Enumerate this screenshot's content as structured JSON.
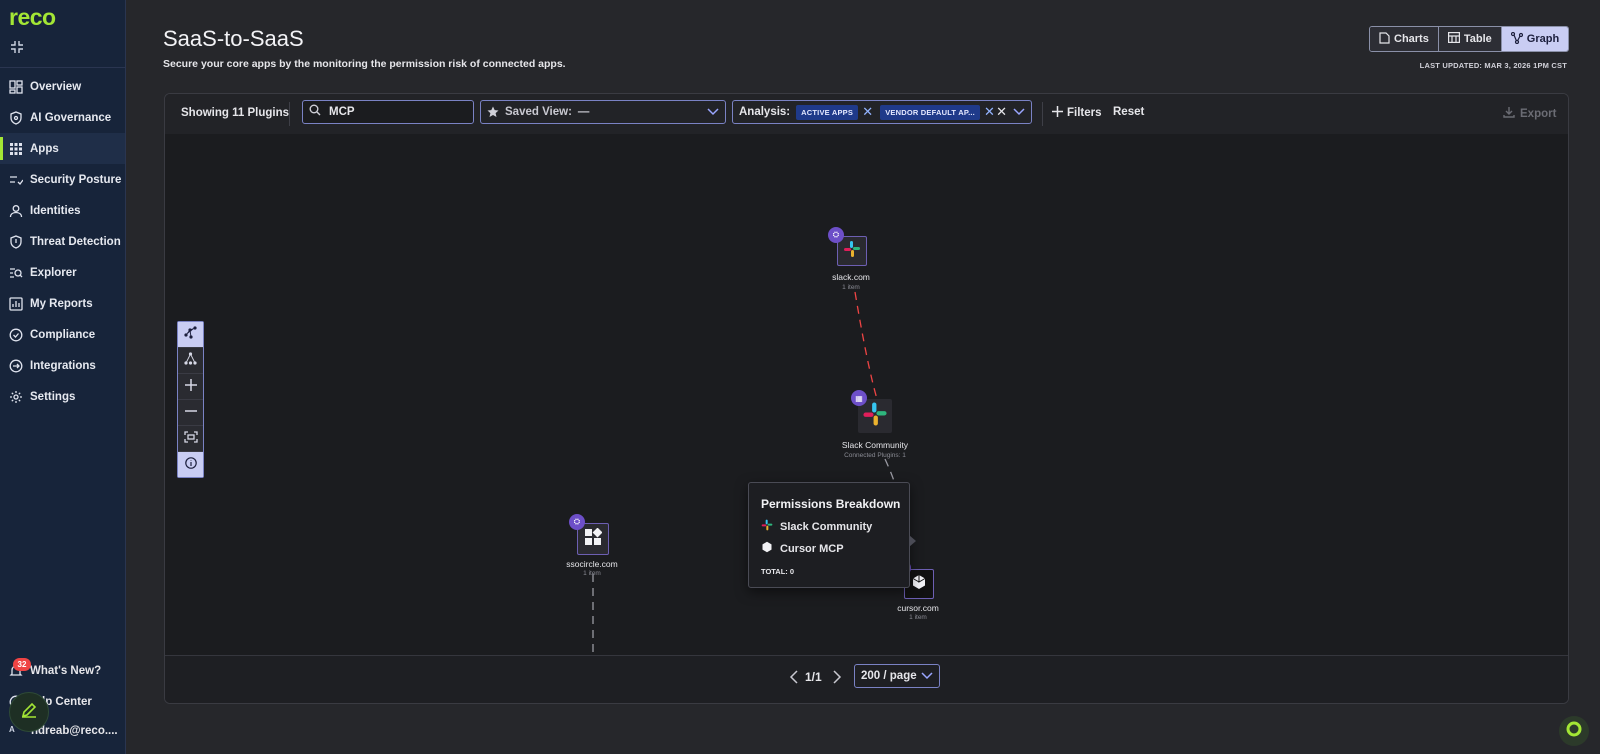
{
  "brand": {
    "name": "reco",
    "accent": "#a3e635"
  },
  "sidebar": {
    "items": [
      {
        "label": "Overview",
        "icon": "dashboard-icon"
      },
      {
        "label": "AI Governance",
        "icon": "shield-ai-icon"
      },
      {
        "label": "Apps",
        "icon": "apps-grid-icon",
        "active": true
      },
      {
        "label": "Security Posture",
        "icon": "posture-check-icon"
      },
      {
        "label": "Identities",
        "icon": "user-icon"
      },
      {
        "label": "Threat Detection",
        "icon": "shield-icon"
      },
      {
        "label": "Explorer",
        "icon": "explorer-search-icon"
      },
      {
        "label": "My Reports",
        "icon": "reports-icon"
      },
      {
        "label": "Compliance",
        "icon": "check-circle-icon"
      },
      {
        "label": "Integrations",
        "icon": "integrations-icon"
      },
      {
        "label": "Settings",
        "icon": "gear-icon"
      }
    ],
    "whats_new": {
      "label": "What's New?",
      "badge": "32"
    },
    "help_center": {
      "label": "Help Center",
      "visible_text": "lp Center"
    },
    "user": {
      "initial": "A",
      "label": "ndreab@reco...."
    }
  },
  "header": {
    "title": "SaaS-to-SaaS",
    "subtitle": "Secure your core apps by the monitoring the permission risk of connected apps.",
    "views": [
      {
        "label": "Charts",
        "icon": "document-icon"
      },
      {
        "label": "Table",
        "icon": "table-icon"
      },
      {
        "label": "Graph",
        "icon": "graph-icon",
        "active": true
      }
    ],
    "last_updated": "LAST UPDATED: MAR 3, 2026 1PM CST"
  },
  "toolbar": {
    "showing": "Showing 11 Plugins",
    "search_value": "MCP",
    "saved_view_label": "Saved View:",
    "saved_view_value": "—",
    "analysis_label": "Analysis:",
    "analysis_chips": [
      "ACTIVE APPS",
      "VENDOR DEFAULT AP..."
    ],
    "filters_label": "Filters",
    "reset_label": "Reset",
    "export_label": "Export"
  },
  "graph": {
    "nodes": [
      {
        "label": "slack.com",
        "sub": "1 item"
      },
      {
        "label": "Slack Community",
        "sub": "Connected Plugins: 1"
      },
      {
        "label": "ssocircle.com",
        "sub": "1 item"
      },
      {
        "label": "cursor.com",
        "sub": "1 item"
      }
    ],
    "edge_colors": {
      "risk": "#ef4444",
      "normal": "#9a9aa3"
    }
  },
  "tooltip": {
    "title": "Permissions Breakdown",
    "rows": [
      "Slack Community",
      "Cursor MCP"
    ],
    "total": "TOTAL: 0"
  },
  "pagination": {
    "page": "1/1",
    "per_page": "200 / page"
  }
}
